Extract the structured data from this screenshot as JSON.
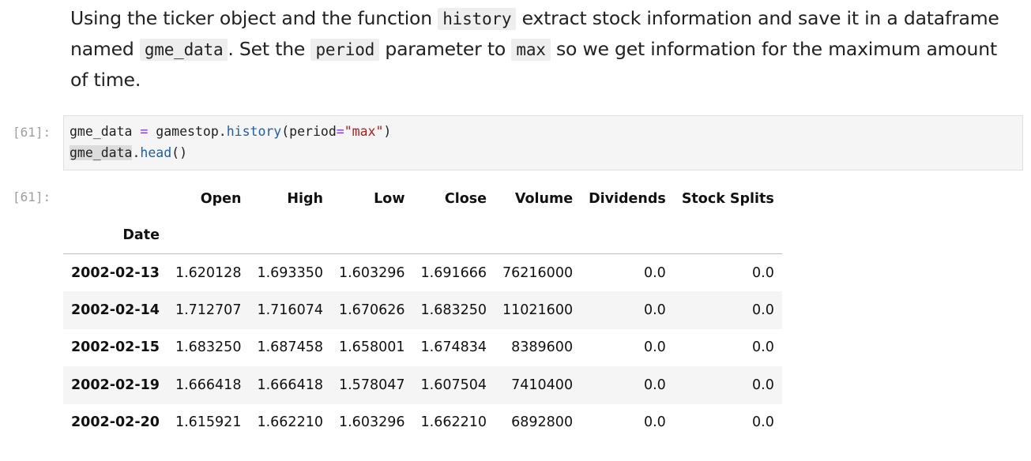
{
  "markdown": {
    "p1": "Using the ticker object and the function ",
    "code1": "history",
    "p2": " extract stock information and save it in a dataframe named ",
    "code2": "gme_data",
    "p3": ". Set the ",
    "code3": "period",
    "p4": " parameter to ",
    "code4": "max",
    "p5": " so we get information for the maximum amount of time."
  },
  "cell": {
    "in_prompt": "[61]:",
    "out_prompt": "[61]:",
    "line1": {
      "var": "gme_data",
      "op": " = ",
      "obj": "gamestop.",
      "fn": "history",
      "open": "(period",
      "eq": "=",
      "str": "\"max\"",
      "close": ")"
    },
    "line2": {
      "var": "gme_data",
      "dot": ".",
      "fn": "head",
      "parens": "()"
    }
  },
  "dataframe": {
    "columns": [
      "Open",
      "High",
      "Low",
      "Close",
      "Volume",
      "Dividends",
      "Stock Splits"
    ],
    "index_name": "Date",
    "rows": [
      {
        "date": "2002-02-13",
        "values": [
          "1.620128",
          "1.693350",
          "1.603296",
          "1.691666",
          "76216000",
          "0.0",
          "0.0"
        ]
      },
      {
        "date": "2002-02-14",
        "values": [
          "1.712707",
          "1.716074",
          "1.670626",
          "1.683250",
          "11021600",
          "0.0",
          "0.0"
        ]
      },
      {
        "date": "2002-02-15",
        "values": [
          "1.683250",
          "1.687458",
          "1.658001",
          "1.674834",
          "8389600",
          "0.0",
          "0.0"
        ]
      },
      {
        "date": "2002-02-19",
        "values": [
          "1.666418",
          "1.666418",
          "1.578047",
          "1.607504",
          "7410400",
          "0.0",
          "0.0"
        ]
      },
      {
        "date": "2002-02-20",
        "values": [
          "1.615921",
          "1.662210",
          "1.603296",
          "1.662210",
          "6892800",
          "0.0",
          "0.0"
        ]
      }
    ]
  }
}
